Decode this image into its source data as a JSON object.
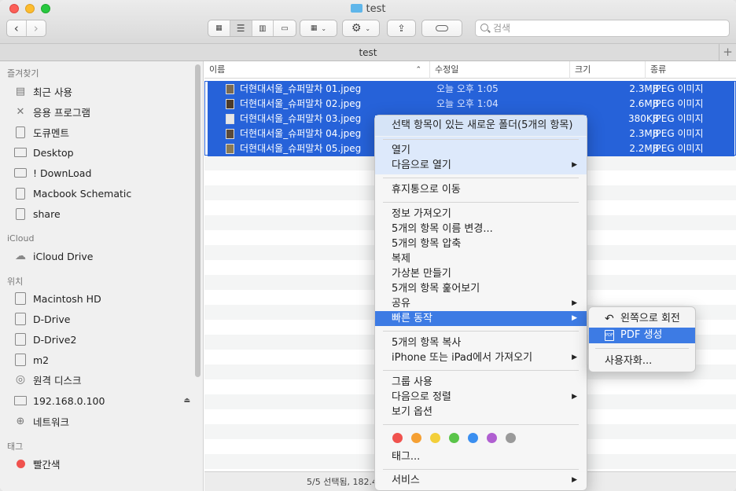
{
  "window": {
    "title": "test",
    "tab_label": "test",
    "tab_add": "+"
  },
  "search": {
    "placeholder": "검색"
  },
  "sidebar": {
    "sections": [
      "즐겨찾기",
      "iCloud",
      "위치",
      "태그"
    ],
    "favorites": [
      "최근 사용",
      "응용 프로그램",
      "도큐멘트",
      "Desktop",
      "! DownLoad",
      "Macbook Schematic",
      "share"
    ],
    "icloud": [
      "iCloud Drive"
    ],
    "locations": [
      "Macintosh HD",
      "D-Drive",
      "D-Drive2",
      "m2",
      "원격 디스크",
      "192.168.0.100",
      "네트워크"
    ],
    "tags": [
      "빨간색"
    ]
  },
  "columns": {
    "name": "이름",
    "date": "수정일",
    "size": "크기",
    "kind": "종류"
  },
  "files": [
    {
      "name": "더현대서울_슈퍼말차 01.jpeg",
      "date": "오늘 오후 1:05",
      "size": "2.3MB",
      "kind": "JPEG 이미지"
    },
    {
      "name": "더현대서울_슈퍼말차 02.jpeg",
      "date": "오늘 오후 1:04",
      "size": "2.6MB",
      "kind": "JPEG 이미지"
    },
    {
      "name": "더현대서울_슈퍼말차 03.jpeg",
      "date": "",
      "size": "380KB",
      "kind": "JPEG 이미지"
    },
    {
      "name": "더현대서울_슈퍼말차 04.jpeg",
      "date": "",
      "size": "2.3MB",
      "kind": "JPEG 이미지"
    },
    {
      "name": "더현대서울_슈퍼말차 05.jpeg",
      "date": "",
      "size": "2.2MB",
      "kind": "JPEG 이미지"
    }
  ],
  "status": "5/5 선택됨, 182.4",
  "context_menu": {
    "new_folder": "선택 항목이 있는 새로운 폴더(5개의 항목)",
    "open": "열기",
    "open_with": "다음으로 열기",
    "trash": "휴지통으로 이동",
    "get_info": "정보 가져오기",
    "rename": "5개의 항목 이름 변경...",
    "compress": "5개의 항목 압축",
    "duplicate": "복제",
    "alias": "가상본 만들기",
    "quicklook": "5개의 항목 훑어보기",
    "share": "공유",
    "quick_actions": "빠른 동작",
    "copy": "5개의 항목 복사",
    "import": "iPhone 또는 iPad에서 가져오기",
    "use_groups": "그룹 사용",
    "sort_by": "다음으로 정렬",
    "view_options": "보기 옵션",
    "tags": "태그...",
    "services": "서비스",
    "tag_colors": [
      "#f0524e",
      "#f5a033",
      "#f3cf3a",
      "#5ac449",
      "#3b8ff0",
      "#b05fd1",
      "#9a9a9a"
    ]
  },
  "submenu": {
    "rotate_left": "왼쪽으로 회전",
    "create_pdf": "PDF 생성",
    "pdf_icon_text": "PDF",
    "customize": "사용자화..."
  }
}
